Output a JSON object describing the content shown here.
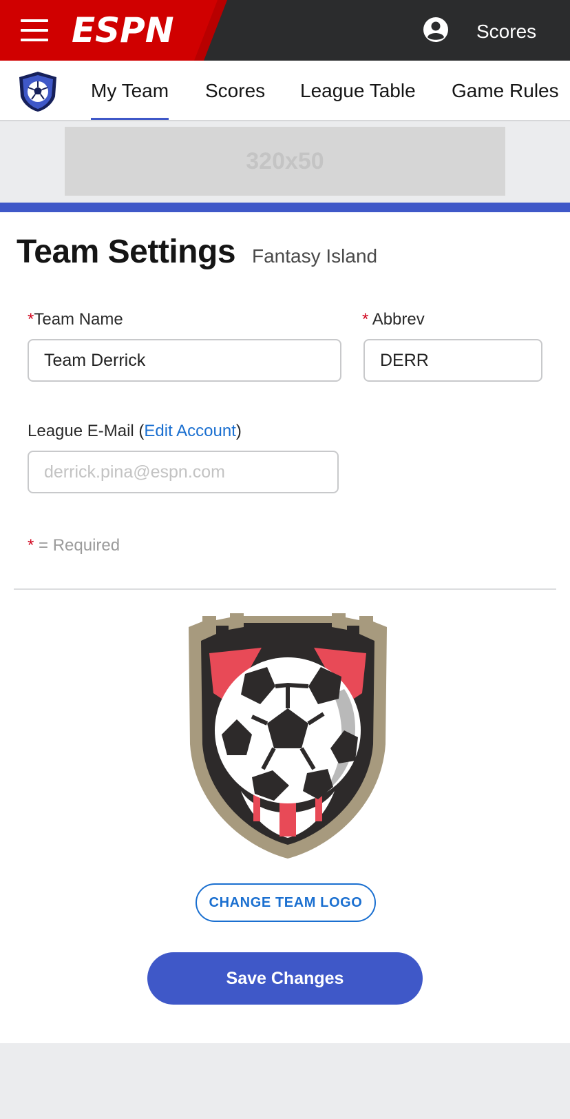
{
  "header": {
    "brand": "ESPN",
    "brand_color": "#d00000",
    "scores_label": "Scores",
    "icons": [
      "hamburger-menu-icon",
      "espn-logo",
      "user-account-icon"
    ]
  },
  "subnav": {
    "tabs": [
      {
        "label": "My Team",
        "active": true
      },
      {
        "label": "Scores",
        "active": false
      },
      {
        "label": "League Table",
        "active": false
      },
      {
        "label": "Game Rules",
        "active": false
      }
    ],
    "accent_color": "#3f58c8"
  },
  "ad": {
    "label": "320x50"
  },
  "page": {
    "title": "Team Settings",
    "league_name": "Fantasy Island"
  },
  "form": {
    "team_name": {
      "required_mark": "*",
      "label": "Team Name",
      "value": "Team Derrick"
    },
    "abbrev": {
      "required_mark": "*",
      "label": "Abbrev",
      "value": "DERR"
    },
    "email": {
      "label_prefix": "League E-Mail (",
      "link_text": "Edit Account",
      "label_suffix": ")",
      "placeholder": "derrick.pina@espn.com"
    },
    "required_note": {
      "mark": "*",
      "text": " = Required"
    }
  },
  "actions": {
    "change_logo_label": "CHANGE TEAM LOGO",
    "save_label": "Save Changes"
  }
}
